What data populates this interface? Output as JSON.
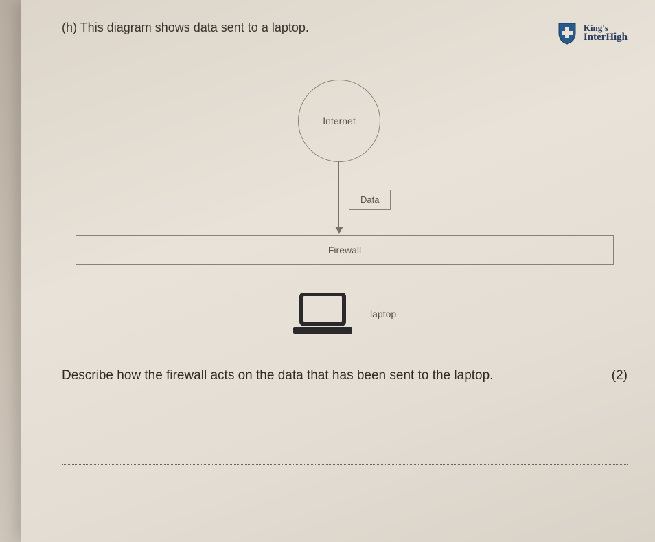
{
  "header": {
    "question_label": "(h)",
    "intro_text": "This diagram shows data sent to a laptop.",
    "logo": {
      "line1": "King's",
      "line2": "InterHigh"
    }
  },
  "diagram": {
    "internet_label": "Internet",
    "data_label": "Data",
    "firewall_label": "Firewall",
    "laptop_label": "laptop"
  },
  "question": {
    "text": "Describe how the firewall acts on the data that has been sent to the laptop.",
    "marks": "(2)"
  }
}
